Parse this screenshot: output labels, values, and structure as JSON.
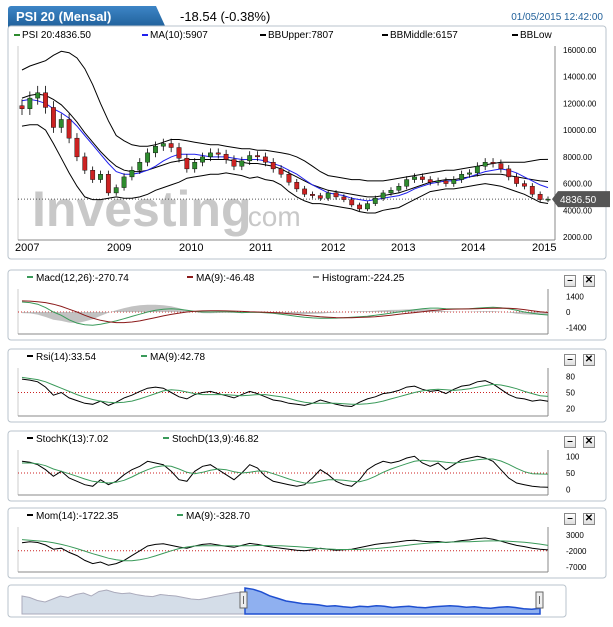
{
  "header": {
    "title": "PSI 20 (Mensal)",
    "change": "-18.54 (-0.38%)",
    "datetime": "01/05/2015 12:42:00"
  },
  "watermark": {
    "brand": "Investing",
    ".com": ".com"
  },
  "colors": {
    "price_up": "#2e8b2e",
    "price_down": "#cc2222",
    "ma": "#2020ee",
    "bb": "#000000",
    "signal": "#3a9a5a",
    "macd": "#111111",
    "hist": "#888888",
    "blue_nav": "#1f4fd0",
    "last_badge": "#555555"
  },
  "chart_data": [
    {
      "type": "candlestick",
      "legend": {
        "price": "PSI 20:4836.50",
        "ma": "MA(10):5907",
        "bbu": "BBUpper:7807",
        "bbm": "BBMiddle:6157",
        "bbl": "BBLow"
      },
      "last_value_label": "4836.50",
      "x_ticks": [
        "2007",
        "2009",
        "2010",
        "2011",
        "2012",
        "2013",
        "2014",
        "2015"
      ],
      "y_ticks": [
        "16000.00",
        "14000.00",
        "12000.00",
        "10000.00",
        "8000.00",
        "6000.00",
        "4000.00",
        "2000.00"
      ],
      "ylim": [
        2000,
        16000
      ],
      "close": [
        11600,
        12400,
        12800,
        11700,
        10200,
        10800,
        9400,
        8000,
        7000,
        6300,
        6700,
        5300,
        5700,
        6500,
        7000,
        7600,
        8300,
        8800,
        9000,
        8700,
        7900,
        7100,
        7600,
        8000,
        8300,
        8200,
        7800,
        7300,
        7700,
        8100,
        8000,
        7600,
        7100,
        6700,
        6100,
        5600,
        5200,
        5100,
        4900,
        5300,
        5000,
        4800,
        4400,
        4100,
        4500,
        4900,
        5300,
        5500,
        5800,
        6300,
        6500,
        6300,
        6100,
        6200,
        6000,
        6300,
        6700,
        6800,
        7300,
        7600,
        7500,
        7100,
        6500,
        6000,
        5800,
        5200,
        4800,
        4836
      ],
      "ma": [
        12200,
        12300,
        12200,
        12000,
        11600,
        11300,
        10900,
        10300,
        9600,
        8900,
        8200,
        7500,
        6900,
        6700,
        6700,
        6800,
        7000,
        7300,
        7700,
        8000,
        8200,
        8200,
        8200,
        8100,
        8000,
        8000,
        8000,
        7900,
        7800,
        7800,
        7800,
        7700,
        7500,
        7300,
        7000,
        6700,
        6300,
        5900,
        5600,
        5300,
        5200,
        5100,
        4900,
        4800,
        4700,
        4800,
        4900,
        5000,
        5100,
        5300,
        5600,
        5800,
        6000,
        6100,
        6200,
        6200,
        6300,
        6500,
        6700,
        6900,
        7000,
        7100,
        7000,
        6800,
        6500,
        6200,
        5900,
        5700
      ],
      "bb_upper": [
        14500,
        14800,
        15000,
        15200,
        15600,
        15900,
        15800,
        15400,
        14600,
        13400,
        12000,
        10700,
        9600,
        9200,
        8900,
        8800,
        8800,
        8900,
        9100,
        9300,
        9300,
        9200,
        9100,
        9000,
        8900,
        8900,
        8800,
        8700,
        8600,
        8600,
        8500,
        8500,
        8400,
        8300,
        8200,
        8000,
        7700,
        7300,
        6900,
        6600,
        6500,
        6400,
        6300,
        6300,
        6200,
        6200,
        6200,
        6300,
        6400,
        6500,
        6600,
        6700,
        6800,
        6900,
        7000,
        7000,
        7100,
        7200,
        7300,
        7400,
        7500,
        7600,
        7600,
        7600,
        7600,
        7700,
        7800,
        7807
      ],
      "bb_middle": [
        12400,
        12600,
        12700,
        12600,
        12300,
        11900,
        11300,
        10600,
        9800,
        9100,
        8400,
        7800,
        7300,
        7000,
        6900,
        6900,
        7000,
        7200,
        7400,
        7600,
        7700,
        7800,
        7800,
        7800,
        7800,
        7800,
        7800,
        7700,
        7600,
        7500,
        7500,
        7400,
        7300,
        7100,
        6800,
        6500,
        6200,
        5900,
        5700,
        5500,
        5400,
        5300,
        5200,
        5100,
        5000,
        5000,
        5100,
        5200,
        5300,
        5500,
        5700,
        5900,
        6100,
        6200,
        6300,
        6300,
        6400,
        6500,
        6600,
        6700,
        6700,
        6700,
        6600,
        6500,
        6400,
        6300,
        6200,
        6157
      ],
      "bb_lower": [
        10300,
        10400,
        10400,
        10000,
        9000,
        7900,
        6800,
        5800,
        5000,
        4800,
        4800,
        4900,
        5000,
        4900,
        4900,
        5000,
        5200,
        5500,
        5700,
        5900,
        6100,
        6400,
        6500,
        6600,
        6700,
        6700,
        6800,
        6700,
        6600,
        6400,
        6500,
        6300,
        6200,
        5900,
        5400,
        5000,
        4700,
        4500,
        4500,
        4400,
        4300,
        4200,
        4100,
        3900,
        3800,
        3800,
        4000,
        4100,
        4200,
        4500,
        4800,
        5100,
        5400,
        5500,
        5600,
        5600,
        5700,
        5800,
        5900,
        6000,
        5900,
        5800,
        5600,
        5400,
        5200,
        4900,
        4600,
        4507
      ]
    },
    {
      "type": "line",
      "legend": {
        "macd": "Macd(12,26):-270.74",
        "ma": "MA(9):-46.48",
        "hist": "Histogram:-224.25"
      },
      "y_ticks": [
        "1400",
        "0",
        "-1400"
      ],
      "ylim": [
        -1800,
        1800
      ],
      "macd": [
        900,
        850,
        700,
        400,
        0,
        -300,
        -700,
        -1000,
        -1150,
        -1200,
        -1100,
        -950,
        -800,
        -600,
        -400,
        -200,
        0,
        150,
        250,
        300,
        250,
        150,
        50,
        0,
        0,
        20,
        30,
        0,
        -50,
        -40,
        -30,
        -60,
        -120,
        -200,
        -300,
        -400,
        -480,
        -530,
        -560,
        -560,
        -550,
        -520,
        -480,
        -430,
        -380,
        -300,
        -200,
        -100,
        0,
        100,
        200,
        300,
        350,
        350,
        300,
        280,
        280,
        300,
        350,
        400,
        420,
        380,
        300,
        150,
        0,
        -120,
        -220,
        -270
      ],
      "signal": [
        1000,
        980,
        930,
        850,
        700,
        500,
        250,
        0,
        -300,
        -550,
        -750,
        -880,
        -950,
        -950,
        -900,
        -800,
        -650,
        -500,
        -350,
        -220,
        -100,
        0,
        60,
        100,
        110,
        110,
        100,
        80,
        50,
        20,
        0,
        -20,
        -50,
        -90,
        -150,
        -220,
        -290,
        -360,
        -420,
        -470,
        -500,
        -510,
        -510,
        -490,
        -460,
        -420,
        -360,
        -290,
        -210,
        -130,
        -50,
        30,
        110,
        180,
        230,
        260,
        270,
        280,
        300,
        320,
        340,
        350,
        340,
        300,
        220,
        120,
        20,
        -46
      ]
    },
    {
      "type": "line",
      "legend": {
        "rsi": "Rsi(14):33.54",
        "ma": "MA(9):42.78"
      },
      "y_ticks": [
        "80",
        "50",
        "20"
      ],
      "ylim": [
        10,
        90
      ],
      "rsi": [
        75,
        73,
        70,
        60,
        45,
        50,
        40,
        35,
        30,
        28,
        34,
        26,
        32,
        40,
        45,
        52,
        58,
        60,
        58,
        50,
        42,
        38,
        46,
        50,
        52,
        48,
        44,
        40,
        46,
        52,
        48,
        42,
        36,
        34,
        30,
        28,
        26,
        30,
        36,
        32,
        28,
        25,
        24,
        32,
        38,
        42,
        48,
        50,
        54,
        60,
        62,
        56,
        52,
        54,
        48,
        56,
        62,
        64,
        70,
        72,
        66,
        56,
        46,
        40,
        38,
        34,
        36,
        33.54
      ],
      "ma": [
        78,
        76,
        74,
        70,
        64,
        58,
        52,
        46,
        41,
        37,
        34,
        32,
        31,
        32,
        34,
        38,
        43,
        48,
        53,
        55,
        54,
        51,
        48,
        46,
        46,
        46,
        46,
        45,
        44,
        45,
        46,
        46,
        44,
        42,
        39,
        35,
        32,
        30,
        30,
        30,
        30,
        29,
        28,
        28,
        29,
        31,
        34,
        38,
        42,
        46,
        50,
        53,
        55,
        56,
        55,
        54,
        55,
        57,
        60,
        63,
        65,
        64,
        61,
        57,
        52,
        48,
        44,
        42.78
      ]
    },
    {
      "type": "line",
      "legend": {
        "k": "StochK(13):7.02",
        "d": "StochD(13,9):46.82"
      },
      "y_ticks": [
        "100",
        "50",
        "0"
      ],
      "ylim": [
        -10,
        110
      ],
      "k": [
        85,
        82,
        75,
        60,
        40,
        55,
        35,
        25,
        15,
        10,
        30,
        15,
        25,
        45,
        60,
        70,
        85,
        80,
        75,
        55,
        30,
        25,
        55,
        70,
        75,
        60,
        45,
        30,
        50,
        75,
        65,
        40,
        25,
        20,
        15,
        10,
        15,
        35,
        60,
        45,
        25,
        15,
        10,
        30,
        60,
        75,
        85,
        80,
        85,
        95,
        100,
        80,
        70,
        80,
        60,
        75,
        90,
        95,
        100,
        95,
        85,
        60,
        35,
        20,
        15,
        10,
        8,
        7.02
      ],
      "d": [
        80,
        80,
        78,
        72,
        62,
        55,
        48,
        40,
        32,
        25,
        22,
        20,
        22,
        28,
        38,
        50,
        60,
        68,
        72,
        70,
        62,
        52,
        48,
        52,
        58,
        62,
        60,
        54,
        50,
        52,
        56,
        55,
        48,
        40,
        32,
        25,
        20,
        20,
        25,
        30,
        30,
        28,
        25,
        24,
        30,
        40,
        52,
        62,
        70,
        78,
        85,
        88,
        86,
        85,
        82,
        80,
        82,
        86,
        90,
        92,
        92,
        86,
        76,
        64,
        54,
        48,
        47,
        46.82
      ]
    },
    {
      "type": "line",
      "legend": {
        "mom": "Mom(14):-1722.35",
        "ma": "MA(9):-328.70"
      },
      "y_ticks": [
        "3000",
        "-2000",
        "-7000"
      ],
      "ylim": [
        -8000,
        4500
      ],
      "mom": [
        500,
        800,
        600,
        -200,
        -1500,
        -1200,
        -2500,
        -3500,
        -5000,
        -6000,
        -5500,
        -6500,
        -6000,
        -5000,
        -3500,
        -2000,
        -500,
        0,
        200,
        -300,
        -800,
        -1200,
        -500,
        0,
        200,
        -200,
        -600,
        -900,
        -300,
        300,
        0,
        -500,
        -900,
        -1200,
        -1500,
        -1800,
        -2000,
        -1700,
        -1200,
        -1500,
        -1800,
        -1700,
        -1500,
        -1000,
        -500,
        0,
        300,
        500,
        800,
        1200,
        1300,
        1000,
        800,
        900,
        600,
        800,
        1200,
        1400,
        1800,
        2000,
        1600,
        1000,
        300,
        -300,
        -700,
        -1200,
        -1500,
        -1722
      ],
      "ma": [
        1500,
        1300,
        1100,
        900,
        500,
        0,
        -600,
        -1300,
        -2100,
        -2900,
        -3600,
        -4300,
        -4800,
        -5100,
        -5100,
        -4800,
        -4300,
        -3600,
        -2800,
        -2000,
        -1300,
        -800,
        -500,
        -400,
        -400,
        -400,
        -400,
        -450,
        -450,
        -400,
        -350,
        -350,
        -400,
        -450,
        -550,
        -700,
        -900,
        -1100,
        -1300,
        -1450,
        -1550,
        -1600,
        -1600,
        -1550,
        -1450,
        -1300,
        -1100,
        -850,
        -600,
        -300,
        0,
        250,
        450,
        600,
        700,
        750,
        800,
        850,
        950,
        1050,
        1100,
        1100,
        1000,
        850,
        650,
        400,
        100,
        -328
      ]
    }
  ],
  "panels": {
    "close": "✕",
    "minimize": "–"
  }
}
